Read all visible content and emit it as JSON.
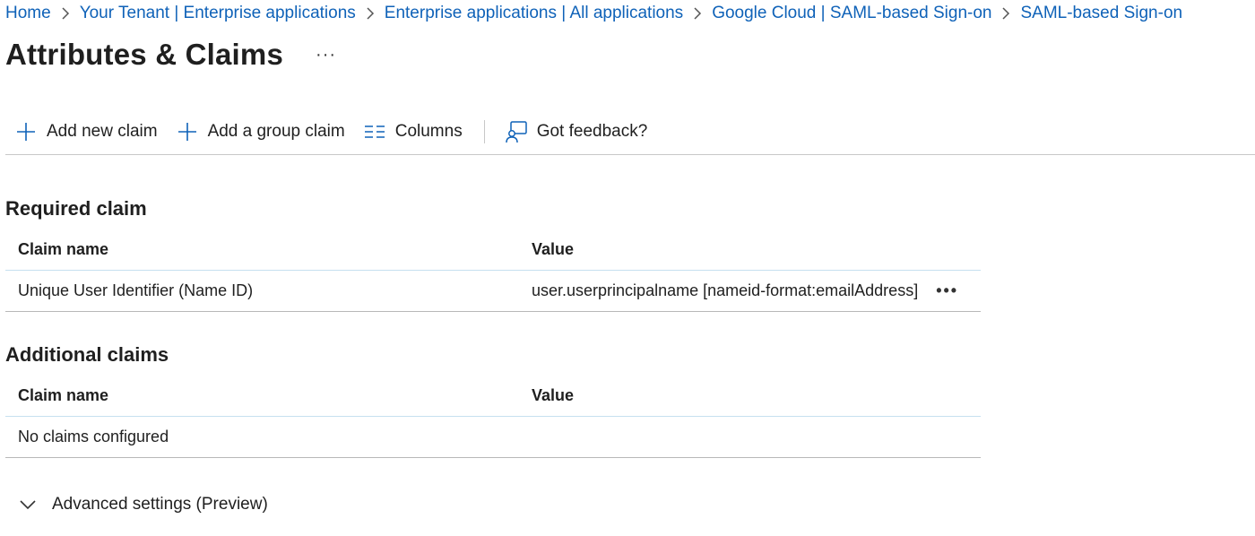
{
  "breadcrumb": {
    "items": [
      "Home",
      "Your Tenant | Enterprise applications",
      "Enterprise applications | All applications",
      "Google Cloud | SAML-based Sign-on",
      "SAML-based Sign-on"
    ]
  },
  "header": {
    "title": "Attributes & Claims",
    "more": "···"
  },
  "toolbar": {
    "add_new_claim": "Add new claim",
    "add_group_claim": "Add a group claim",
    "columns": "Columns",
    "feedback": "Got feedback?"
  },
  "required": {
    "title": "Required claim",
    "columns": [
      "Claim name",
      "Value"
    ],
    "rows": [
      {
        "name": "Unique User Identifier (Name ID)",
        "value": "user.userprincipalname [nameid-format:emailAddress]",
        "more": "•••"
      }
    ]
  },
  "additional": {
    "title": "Additional claims",
    "columns": [
      "Claim name",
      "Value"
    ],
    "empty_text": "No claims configured"
  },
  "advanced": {
    "label": "Advanced settings (Preview)"
  },
  "colors": {
    "link": "#0f62b8",
    "accent": "#0f62b8"
  }
}
